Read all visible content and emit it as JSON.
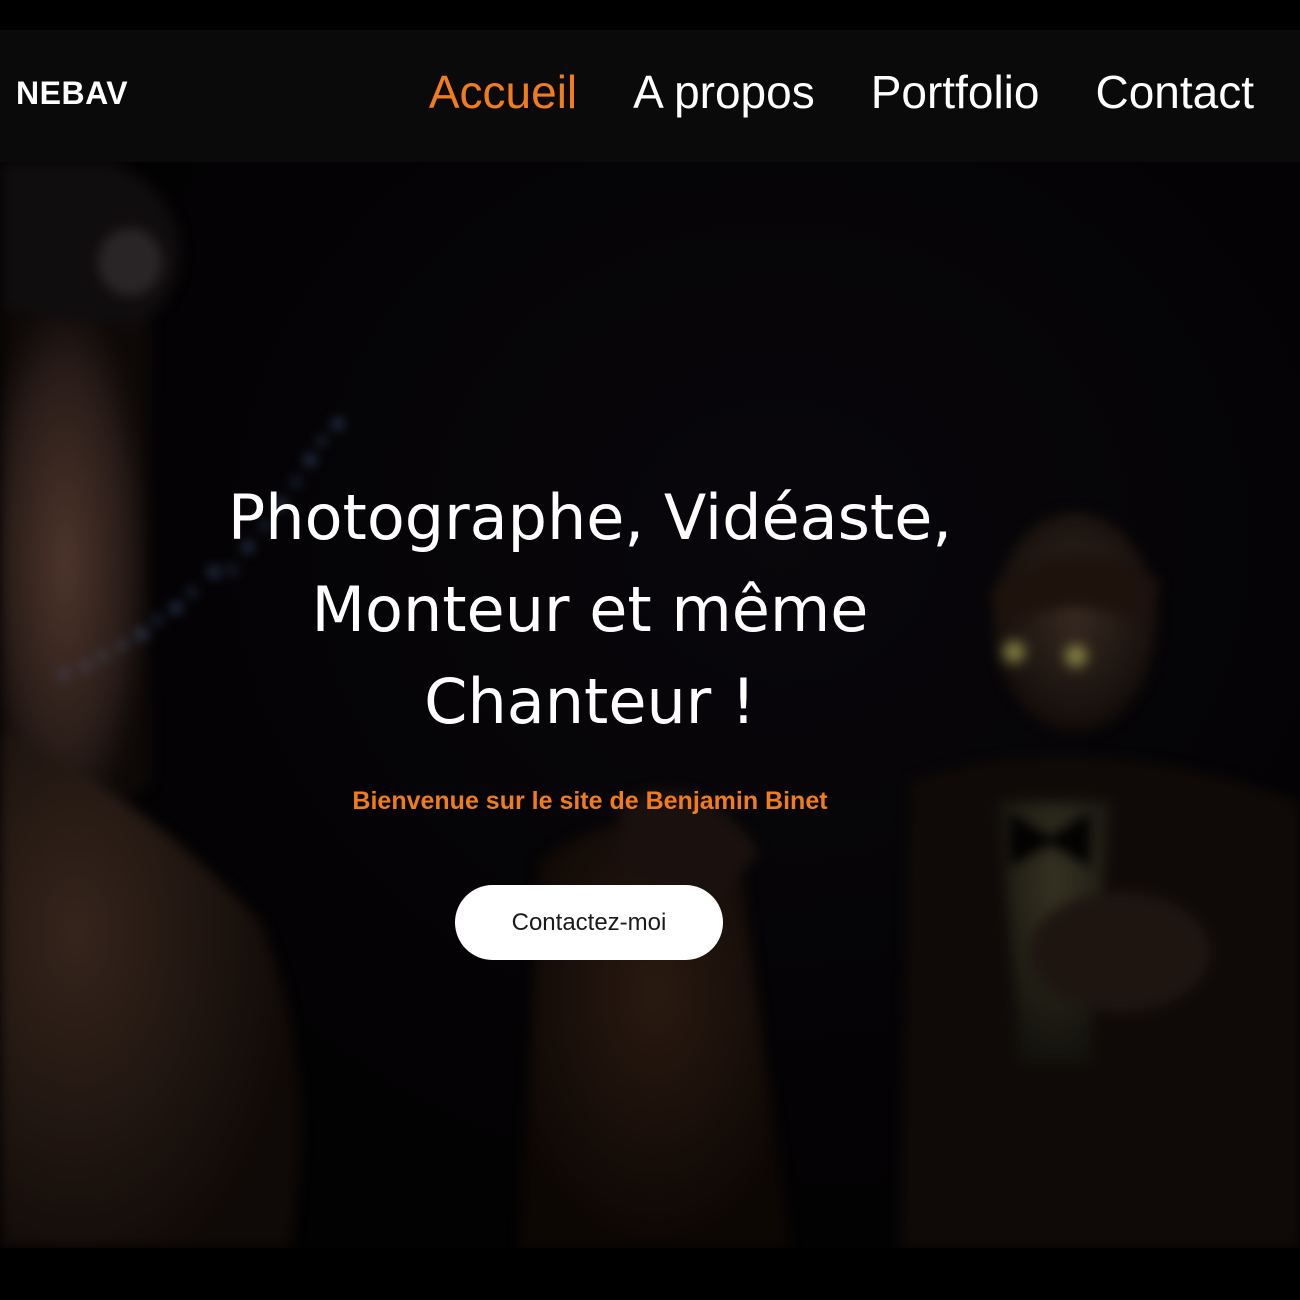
{
  "header": {
    "brand": "NEBAV",
    "nav": [
      {
        "label": "Accueil",
        "active": true
      },
      {
        "label": "A propos",
        "active": false
      },
      {
        "label": "Portfolio",
        "active": false
      },
      {
        "label": "Contact",
        "active": false
      }
    ]
  },
  "hero": {
    "headline_lines": [
      "Photographe, Vidéaste,",
      "Monteur et même",
      "Chanteur !"
    ],
    "subtitle": "Bienvenue sur le site de Benjamin Binet",
    "cta_label": "Contactez-moi",
    "background": "blurred night scene with a woman in a hat in the foreground and a man in a bow tie and glowing glasses, string of blue lights"
  },
  "colors": {
    "accent": "#f07c1b",
    "nav_background": "#0a0a0a",
    "page_background": "#000000",
    "button_background": "#ffffff"
  }
}
